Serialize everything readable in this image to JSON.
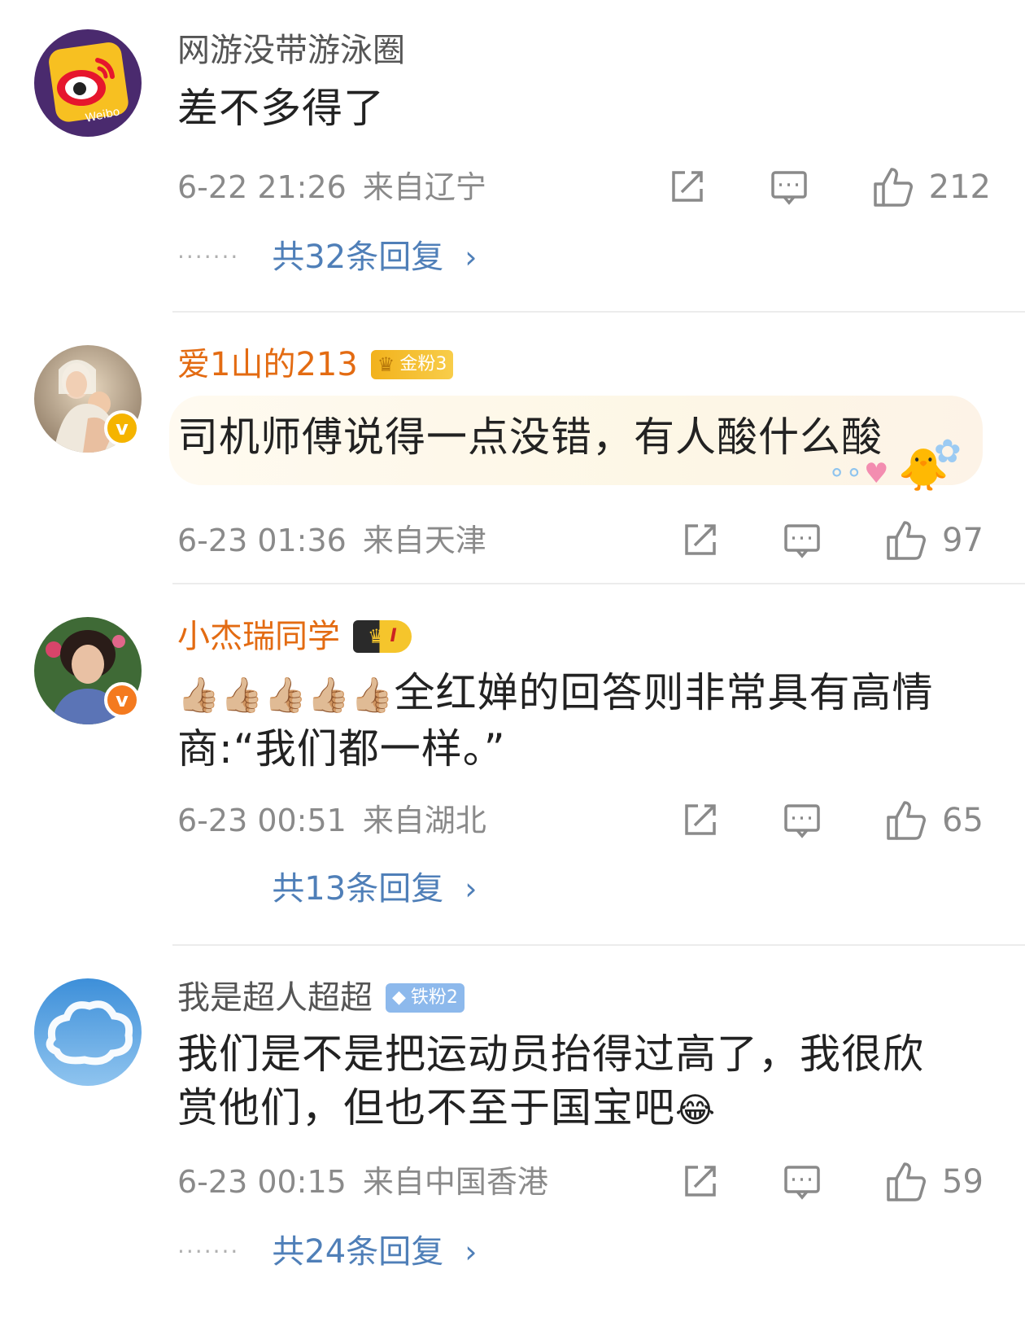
{
  "comments": [
    {
      "username": "网游没带游泳圈",
      "text": "差不多得了",
      "time": "6-22 21:26",
      "location": "来自辽宁",
      "likes": "212",
      "replies": "共32条回复",
      "avatar_text": "Weibo"
    },
    {
      "username": "爱1山的213",
      "badge": "金粉3",
      "text": "司机师傅说得一点没错，有人酸什么酸",
      "time": "6-23 01:36",
      "location": "来自天津",
      "likes": "97"
    },
    {
      "username": "小杰瑞同学",
      "badge": "I",
      "emoji_prefix": "👍🏼👍🏼👍🏼👍🏼👍🏼",
      "text": "全红婵的回答则非常具有高情商:“我们都一样。”",
      "time": "6-23 00:51",
      "location": "来自湖北",
      "likes": "65",
      "replies": "共13条回复"
    },
    {
      "username": "我是超人超超",
      "badge": "铁粉2",
      "text": "我们是不是把运动员抬得过高了，我很欣赏他们，但也不至于国宝吧",
      "emoji_suffix": "😂",
      "time": "6-23 00:15",
      "location": "来自中国香港",
      "likes": "59",
      "replies": "共24条回复"
    }
  ],
  "colors": {
    "link": "#4f7fb8",
    "orange_name": "#e36b12",
    "meta_gray": "#8a8a8a"
  },
  "icons": [
    "share-icon",
    "comment-icon",
    "like-icon",
    "chevron-right-icon",
    "verified-icon",
    "crown-icon"
  ]
}
